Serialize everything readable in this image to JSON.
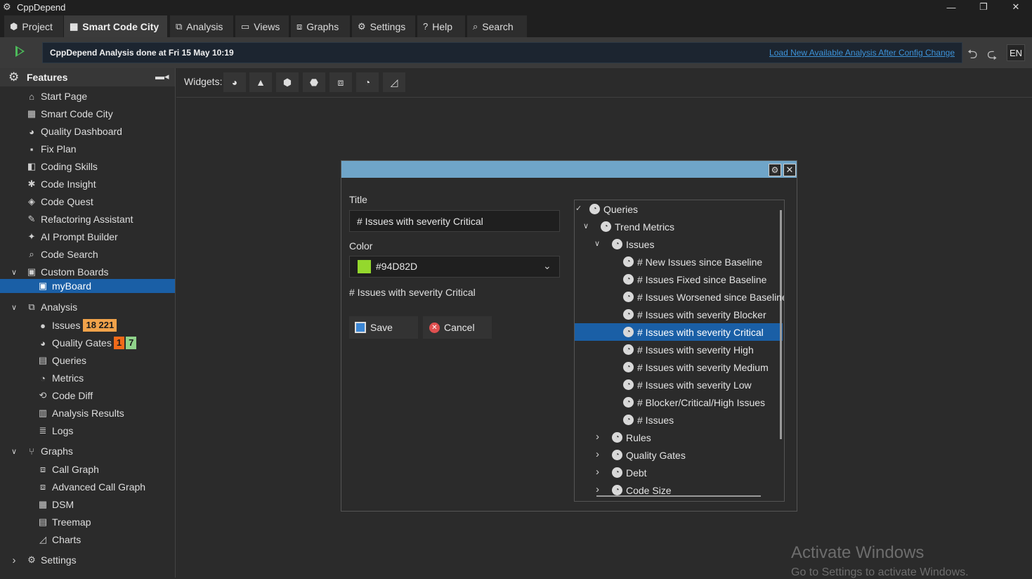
{
  "window": {
    "title": "CppDepend",
    "icon": "gear-icon",
    "minimize": "—",
    "restore": "❐",
    "close": "✕"
  },
  "menu": [
    {
      "label": "Project",
      "icon": "box-icon",
      "glyph": "⬢"
    },
    {
      "label": "Smart Code City",
      "icon": "city-icon",
      "glyph": "▦"
    },
    {
      "label": "Analysis",
      "icon": "analysis-icon",
      "glyph": "⧉"
    },
    {
      "label": "Views",
      "icon": "views-icon",
      "glyph": "▭"
    },
    {
      "label": "Graphs",
      "icon": "graph-icon",
      "glyph": "⧈"
    },
    {
      "label": "Settings",
      "icon": "gear-icon",
      "glyph": "⚙"
    },
    {
      "label": "Help",
      "icon": "help-icon",
      "glyph": "?"
    },
    {
      "label": "Search",
      "icon": "search-icon",
      "glyph": "⌕"
    }
  ],
  "status": {
    "text": "CppDepend Analysis done at Fri 15 May  10:19",
    "link": "Load New Available Analysis After Config Change",
    "lang": "EN",
    "back": "⮌",
    "forward": "⮎"
  },
  "sidebar": {
    "title": "Features",
    "pin": "📌",
    "items": [
      {
        "label": "Start Page",
        "glyph": "⌂"
      },
      {
        "label": "Smart Code City",
        "glyph": "▦"
      },
      {
        "label": "Quality Dashboard",
        "glyph": "◕"
      },
      {
        "label": "Fix Plan",
        "glyph": "▪"
      },
      {
        "label": "Coding Skills",
        "glyph": "◧"
      },
      {
        "label": "Code Insight",
        "glyph": "✱"
      },
      {
        "label": "Code Quest",
        "glyph": "◈"
      },
      {
        "label": "Refactoring Assistant",
        "glyph": "✎"
      },
      {
        "label": "AI Prompt Builder",
        "glyph": "✦"
      },
      {
        "label": "Code Search",
        "glyph": "⌕"
      },
      {
        "label": "Custom Boards",
        "glyph": "▣",
        "chev": "∨"
      },
      {
        "label": "myBoard",
        "glyph": "▣"
      },
      {
        "label": "Analysis",
        "glyph": "⧉",
        "chev": "∨"
      },
      {
        "label": "Issues",
        "glyph": "●",
        "badge": "18 221",
        "badge_color": "#F0A24A"
      },
      {
        "label": "Quality Gates",
        "glyph": "◕",
        "badge": "1",
        "badge_color": "#F06A1A",
        "badge2": "7",
        "badge2_color": "#8FD28A"
      },
      {
        "label": "Queries",
        "glyph": "▤"
      },
      {
        "label": "Metrics",
        "glyph": "◔"
      },
      {
        "label": "Code Diff",
        "glyph": "⟲"
      },
      {
        "label": "Analysis Results",
        "glyph": "▥"
      },
      {
        "label": "Logs",
        "glyph": "≣"
      },
      {
        "label": "Graphs",
        "glyph": "⑂",
        "chev": "∨"
      },
      {
        "label": "Call Graph",
        "glyph": "⧈"
      },
      {
        "label": "Advanced Call Graph",
        "glyph": "⧈"
      },
      {
        "label": "DSM",
        "glyph": "▦"
      },
      {
        "label": "Treemap",
        "glyph": "▤"
      },
      {
        "label": "Charts",
        "glyph": "◿"
      },
      {
        "label": "Settings",
        "glyph": "⚙",
        "chev": "›"
      }
    ]
  },
  "widgets": {
    "label": "Widgets:",
    "buttons": [
      {
        "icon": "dashboard-icon",
        "glyph": "◕"
      },
      {
        "icon": "warning-icon",
        "glyph": "▲"
      },
      {
        "icon": "cube-icon",
        "glyph": "⬢"
      },
      {
        "icon": "gate-icon",
        "glyph": "⬣"
      },
      {
        "icon": "graph-icon",
        "glyph": "⧈"
      },
      {
        "icon": "query-icon",
        "glyph": "◔"
      },
      {
        "icon": "chart-icon",
        "glyph": "◿"
      }
    ]
  },
  "dialog": {
    "title_label": "Title",
    "title_value": "# Issues with severity Critical",
    "color_label": "Color",
    "color_value": "#94D82D",
    "color_hex": "#94D82D",
    "preview": "# Issues with severity Critical",
    "save": "Save",
    "cancel": "Cancel",
    "tree": [
      {
        "label": "Queries",
        "chev": "✓"
      },
      {
        "label": "Trend Metrics",
        "chev": "∨"
      },
      {
        "label": "Issues",
        "chev": "∨"
      },
      {
        "label": "# New Issues since Baseline"
      },
      {
        "label": "# Issues Fixed since Baseline"
      },
      {
        "label": "# Issues Worsened since Baseline"
      },
      {
        "label": "# Issues with severity Blocker"
      },
      {
        "label": "# Issues with severity Critical"
      },
      {
        "label": "# Issues with severity High"
      },
      {
        "label": "# Issues with severity Medium"
      },
      {
        "label": "# Issues with severity Low"
      },
      {
        "label": "# Blocker/Critical/High Issues"
      },
      {
        "label": "# Issues"
      },
      {
        "label": "Rules",
        "chev": "›"
      },
      {
        "label": "Quality Gates",
        "chev": "›"
      },
      {
        "label": "Debt",
        "chev": "›"
      },
      {
        "label": "Code Size",
        "chev": "›"
      }
    ]
  },
  "watermark": {
    "line1": "Activate Windows",
    "line2": "Go to Settings to activate Windows."
  }
}
